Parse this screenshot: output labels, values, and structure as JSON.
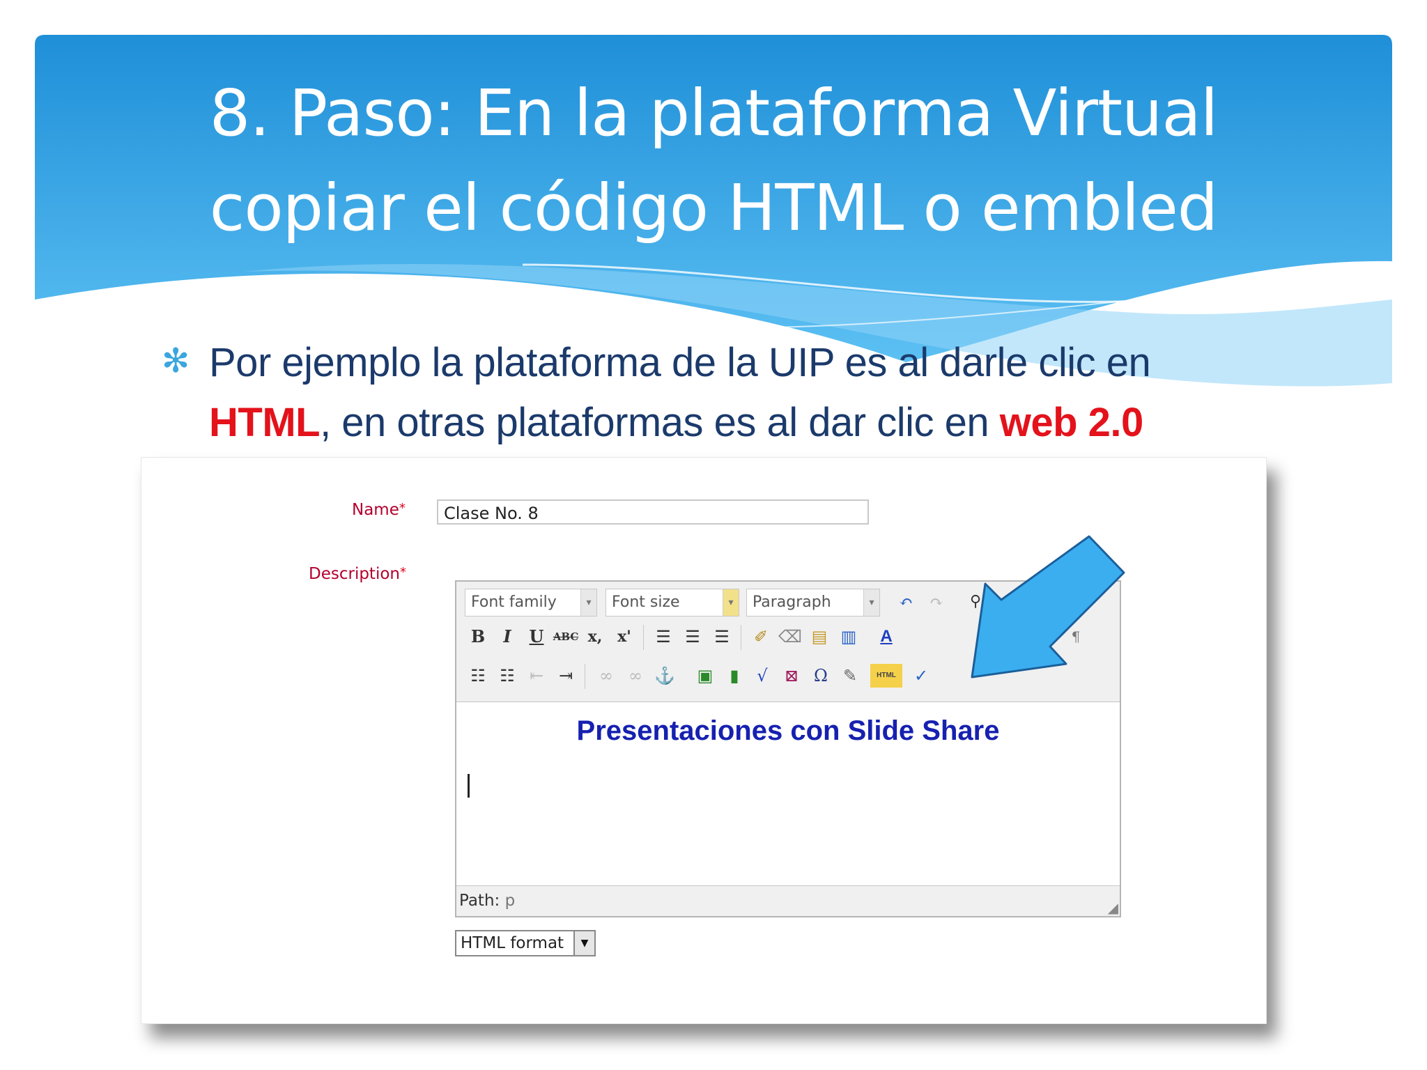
{
  "slide": {
    "title_line1": "8. Paso: En la plataforma Virtual",
    "title_line2": "copiar el código HTML o embled",
    "bullet_icon": "asterisk-bullet-icon",
    "bullet_part1": "Por ejemplo la plataforma de la UIP es al darle clic en",
    "bullet_hl1": "HTML",
    "bullet_part2": ", en otras plataformas es al dar clic en ",
    "bullet_hl2": "web 2.0"
  },
  "colors": {
    "banner": "#34a3e4",
    "highlight": "#e3121b",
    "bullet_text": "#1b3a6b",
    "arrow": "#3baef0"
  },
  "form": {
    "name_label": "Name",
    "required_mark": "*",
    "name_value": "Clase No. 8",
    "description_label": "Description",
    "font_family_label": "Font family",
    "font_size_label": "Font size",
    "paragraph_label": "Paragraph",
    "editor_heading": "Presentaciones con Slide Share",
    "path_label": "Path:",
    "path_value": "p",
    "format_label": "HTML format"
  },
  "toolbar": {
    "bold": "B",
    "italic": "I",
    "underline": "U",
    "strike": "ABC",
    "subscript": "x,",
    "superscript": "x'",
    "html_button": "HTML",
    "omega": "Ω",
    "text_color": "A"
  }
}
